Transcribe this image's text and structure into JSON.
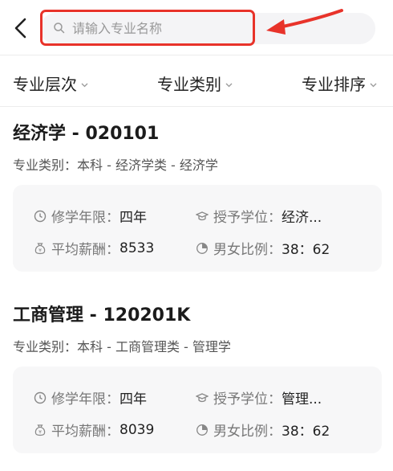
{
  "search": {
    "placeholder": "请输入专业名称"
  },
  "filters": [
    {
      "label": "专业层次"
    },
    {
      "label": "专业类别"
    },
    {
      "label": "专业排序"
    }
  ],
  "majors": [
    {
      "title": "经济学 - 020101",
      "category": "专业类别：本科 - 经济学类 - 经济学",
      "duration_label": "修学年限：",
      "duration_value": "四年",
      "degree_label": "授予学位：",
      "degree_value": "经济...",
      "salary_label": "平均薪酬：",
      "salary_value": "8533",
      "ratio_label": "男女比例：",
      "ratio_value": "38：62"
    },
    {
      "title": "工商管理 - 120201K",
      "category": "专业类别：本科 - 工商管理类 - 管理学",
      "duration_label": "修学年限：",
      "duration_value": "四年",
      "degree_label": "授予学位：",
      "degree_value": "管理...",
      "salary_label": "平均薪酬：",
      "salary_value": "8039",
      "ratio_label": "男女比例：",
      "ratio_value": "38：62"
    }
  ],
  "colors": {
    "highlight": "#e8332a",
    "card_bg": "#f7f7f8",
    "search_bg": "#f4f4f6"
  }
}
